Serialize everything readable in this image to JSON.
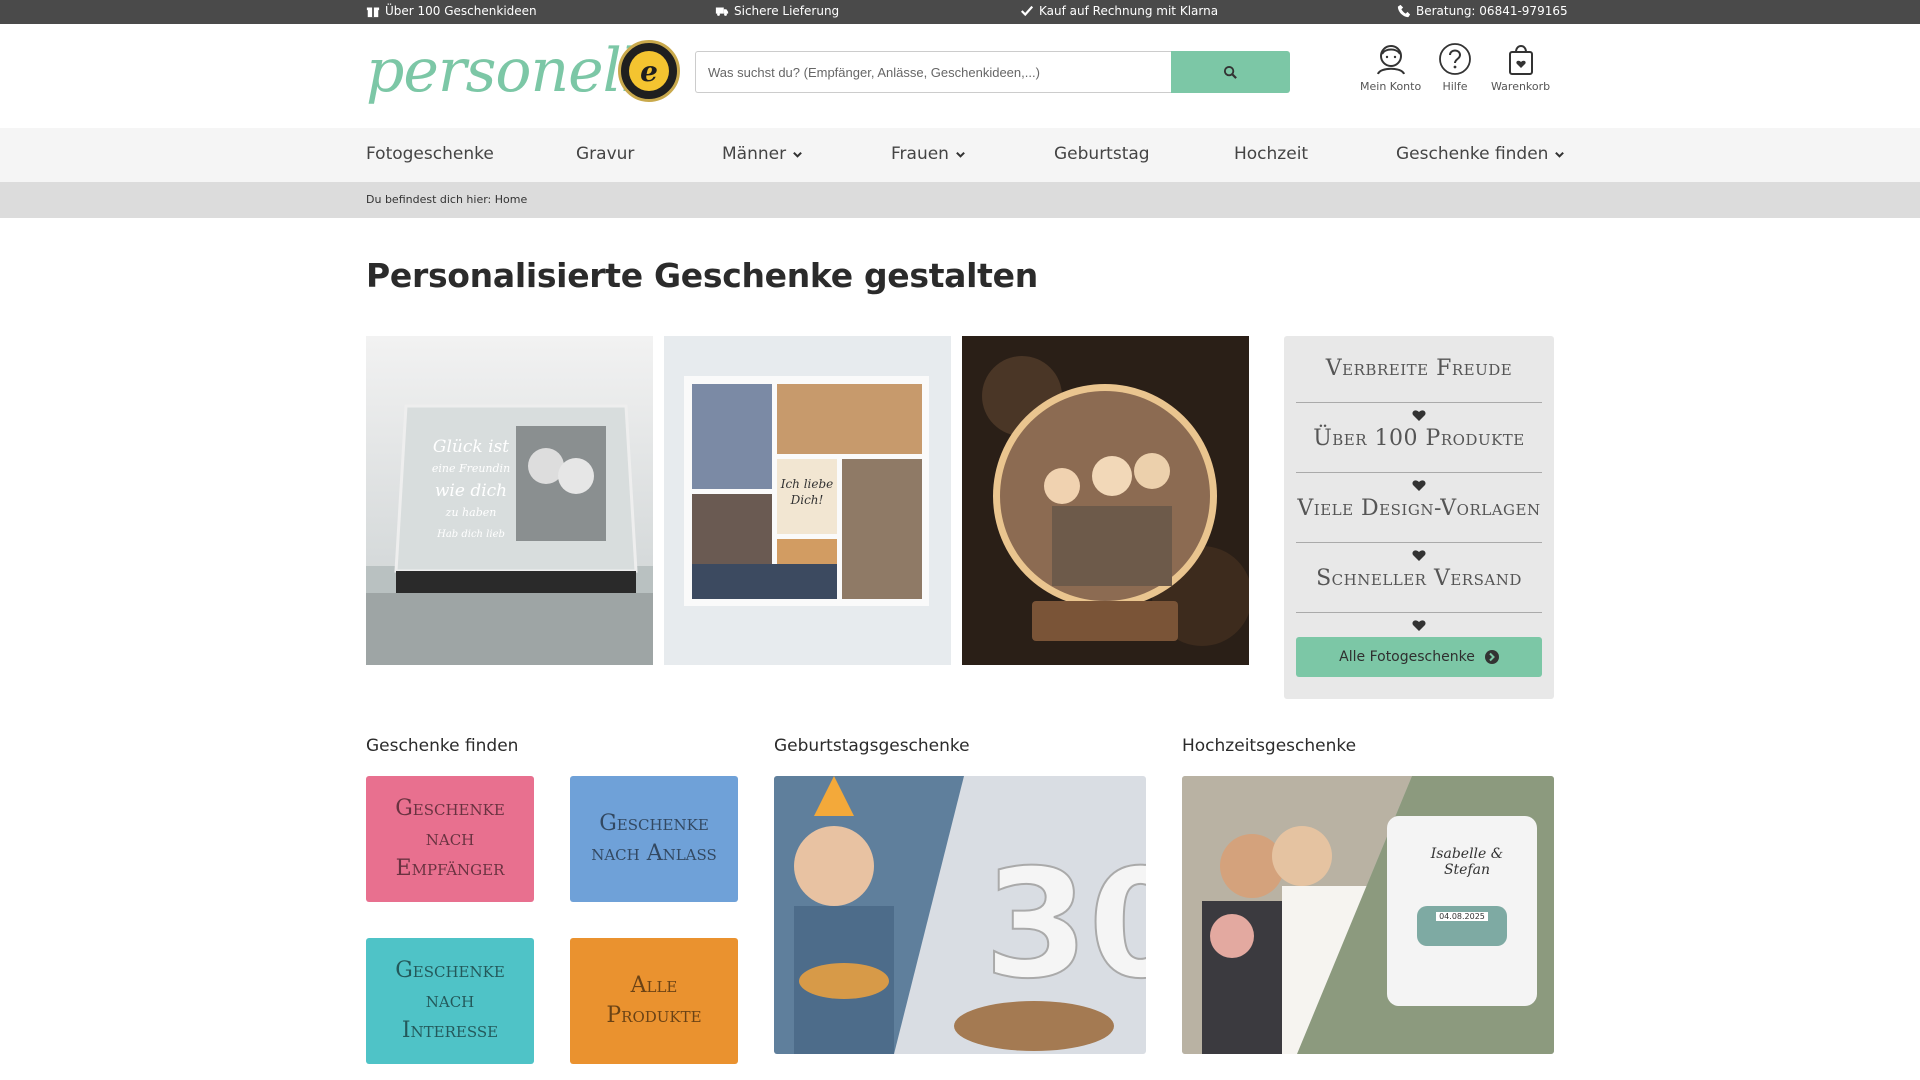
{
  "topbar": {
    "items": [
      {
        "label": "Über 100 Geschenkideen",
        "icon": "gift-icon"
      },
      {
        "label": "Sichere Lieferung",
        "icon": "truck-icon"
      },
      {
        "label": "Kauf auf Rechnung mit Klarna",
        "icon": "check-icon"
      },
      {
        "label": "Beratung: 06841-979165",
        "icon": "phone-icon"
      }
    ]
  },
  "header": {
    "logo": "personello",
    "search_placeholder": "Was suchst du? (Empfänger, Anlässe, Geschenkideen,...)",
    "account_label": "Mein Konto",
    "help_label": "Hilfe",
    "cart_label": "Warenkorb"
  },
  "nav": {
    "items": [
      {
        "label": "Fotogeschenke",
        "dropdown": false
      },
      {
        "label": "Gravur",
        "dropdown": false
      },
      {
        "label": "Männer",
        "dropdown": true
      },
      {
        "label": "Frauen",
        "dropdown": true
      },
      {
        "label": "Geburtstag",
        "dropdown": false
      },
      {
        "label": "Hochzeit",
        "dropdown": false
      },
      {
        "label": "Geschenke finden",
        "dropdown": true
      }
    ]
  },
  "breadcrumb": {
    "prefix": "Du befindest dich hier:",
    "current": "Home"
  },
  "page_title": "Personalisierte Geschenke gestalten",
  "hero_images": {
    "crystal_text": [
      "Glück ist",
      "eine Freundin",
      "wie dich",
      "zu haben",
      "Hab dich lieb"
    ],
    "pillow_text": [
      "Ich liebe",
      "Dich!"
    ]
  },
  "benefits": {
    "items": [
      "Verbreite Freude",
      "Über 100 Produkte",
      "Viele Design-Vorlagen",
      "Schneller Versand"
    ],
    "cta_label": "Alle Fotogeschenke"
  },
  "sections": {
    "finder_title": "Geschenke finden",
    "birthday_title": "Geburtstagsgeschenke",
    "wedding_title": "Hochzeitsgeschenke"
  },
  "finder_tiles": [
    {
      "label": "Geschenke nach Empfänger",
      "color": "#e8708f"
    },
    {
      "label": "Geschenke nach Anlass",
      "color": "#6fa1d8"
    },
    {
      "label": "Geschenke nach Interesse",
      "color": "#4fc3c7"
    },
    {
      "label": "Alle Produkte",
      "color": "#ea922f"
    }
  ],
  "wedding_image_text": {
    "names": "Isabelle & Stefan",
    "date": "04.08.2025"
  },
  "colors": {
    "brand": "#7cc7a6",
    "topbar": "#4a4a4a",
    "nav_bg": "#f5f5f5",
    "breadcrumb_bg": "#dcdcdc"
  }
}
